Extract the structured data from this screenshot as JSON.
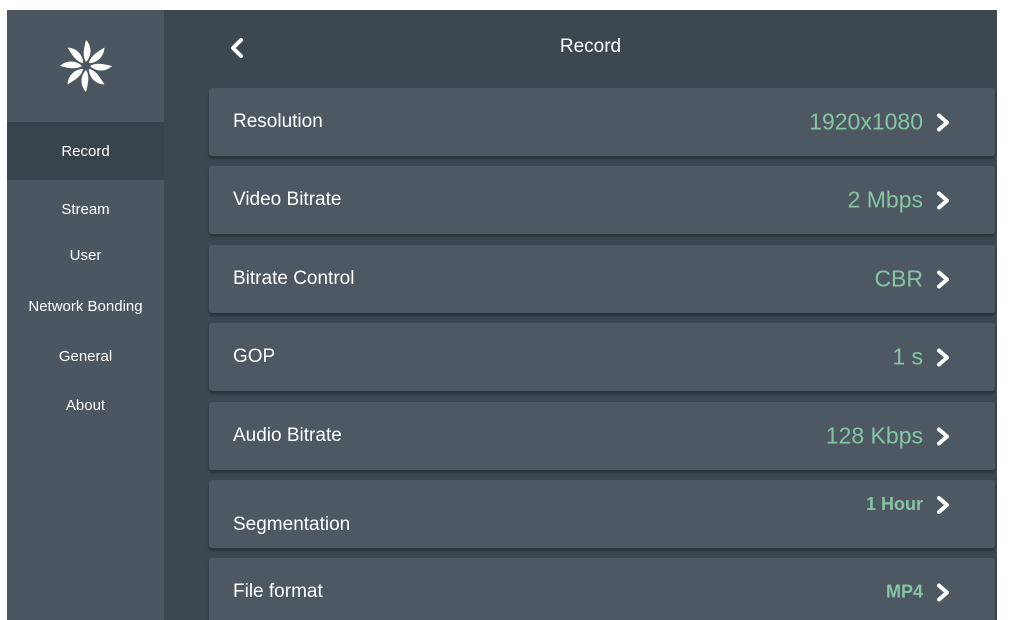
{
  "header": {
    "title": "Record"
  },
  "sidebar": {
    "items": [
      {
        "label": "Record",
        "active": true
      },
      {
        "label": "Stream"
      },
      {
        "label": "User"
      },
      {
        "label": "Network Bonding"
      },
      {
        "label": "General"
      },
      {
        "label": "About"
      }
    ]
  },
  "settings": [
    {
      "label": "Resolution",
      "value": "1920x1080"
    },
    {
      "label": "Video Bitrate",
      "value": "2 Mbps"
    },
    {
      "label": "Bitrate Control",
      "value": "CBR"
    },
    {
      "label": "GOP",
      "value": "1 s"
    },
    {
      "label": "Audio Bitrate",
      "value": "128 Kbps"
    },
    {
      "label": "Segmentation",
      "value": "1 Hour"
    },
    {
      "label": "File format",
      "value": "MP4"
    }
  ],
  "colors": {
    "background": "#3d4750",
    "sidebar": "#4b5660",
    "row": "#4d5862",
    "value_accent": "#86c5a4"
  },
  "icons": {
    "logo": "flower-logo-icon",
    "back": "chevron-left-icon",
    "row": "chevron-right-icon"
  }
}
